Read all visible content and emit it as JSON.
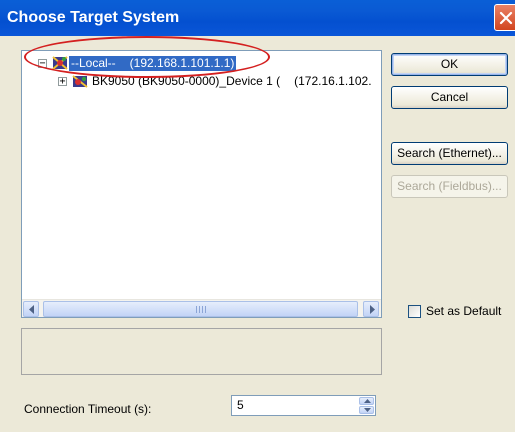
{
  "window": {
    "title": "Choose Target System"
  },
  "tree": {
    "nodes": [
      {
        "expander": "−",
        "label": "--Local--",
        "address": "(192.168.1.101.1.1)",
        "selected": true
      },
      {
        "expander": "+",
        "label": "BK9050 (BK9050-0000)_Device 1 (",
        "address": "(172.16.1.102.",
        "selected": false
      }
    ]
  },
  "buttons": {
    "ok": "OK",
    "cancel": "Cancel",
    "search_ethernet": "Search (Ethernet)...",
    "search_fieldbus": "Search (Fieldbus)..."
  },
  "set_as_default": {
    "label": "Set as Default",
    "checked": false
  },
  "timeout": {
    "label": "Connection Timeout (s):",
    "value": "5"
  },
  "colors": {
    "title_bar": "#0a5ad4",
    "selection": "#316ac5",
    "annotation_ring": "#d42020"
  },
  "icons": [
    "close-icon",
    "network-icon",
    "device-icon",
    "scroll-left-icon",
    "scroll-right-icon",
    "spin-up-icon",
    "spin-down-icon"
  ]
}
